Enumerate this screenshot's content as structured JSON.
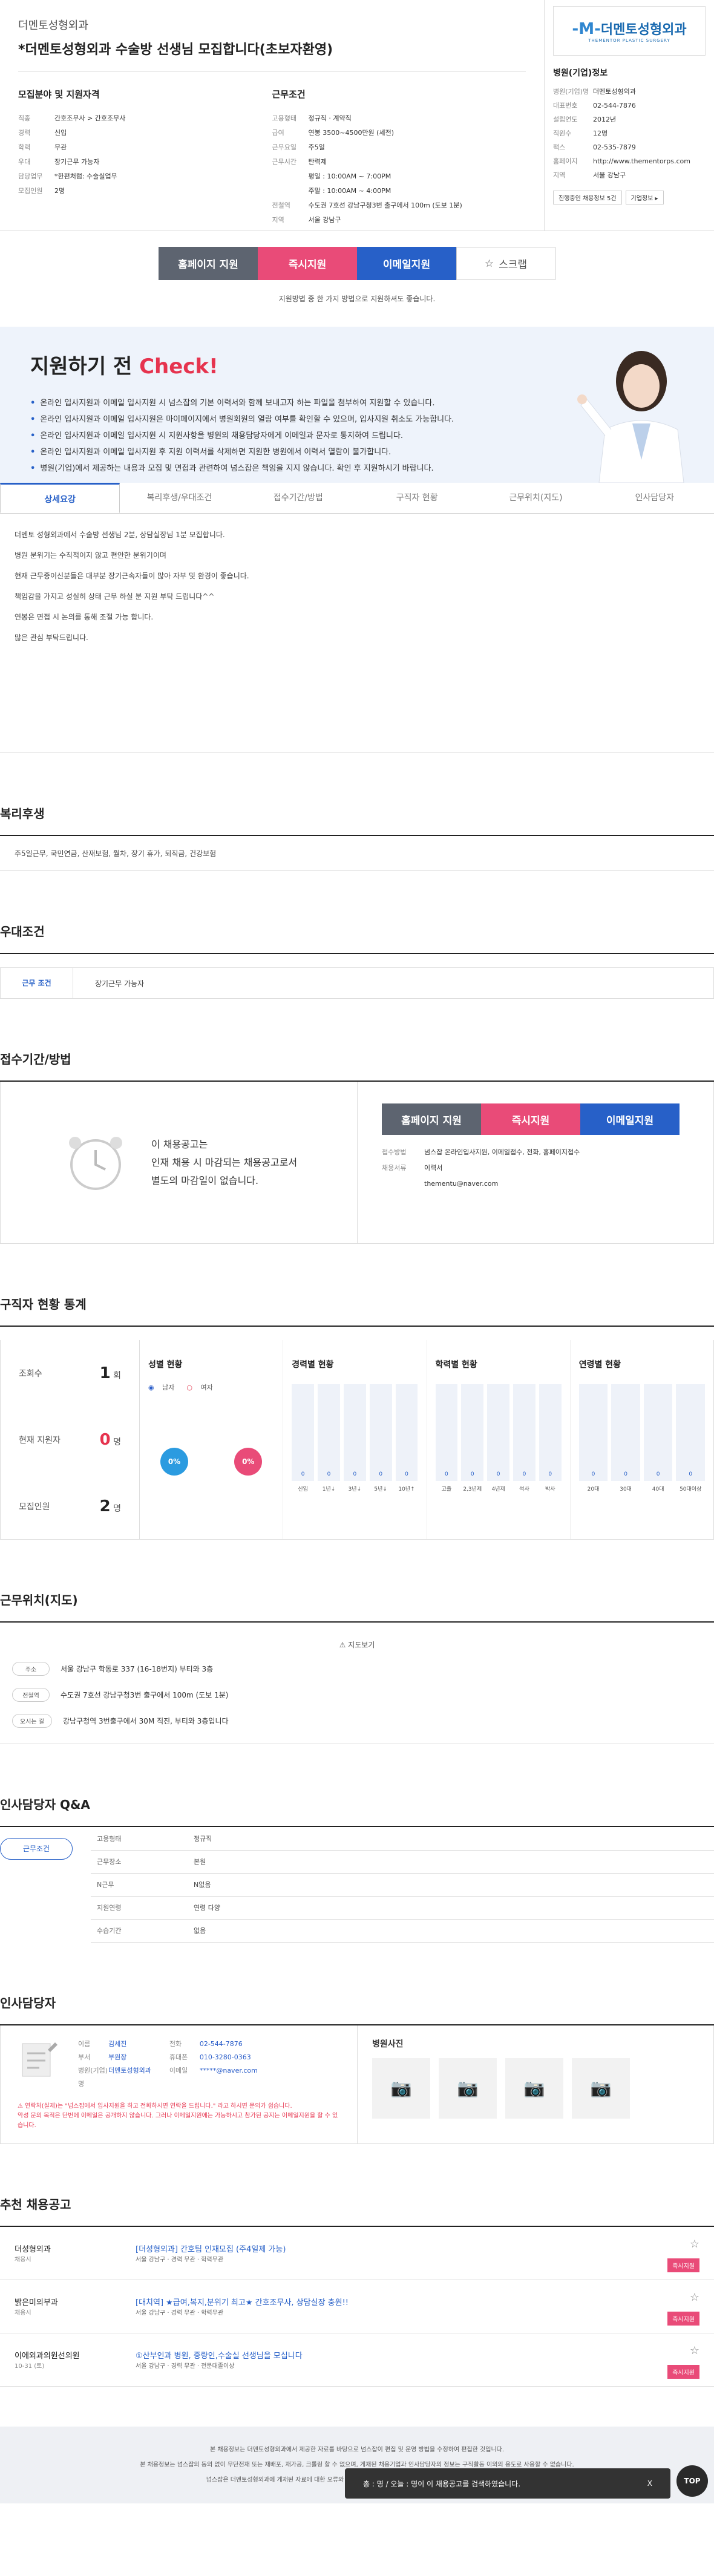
{
  "header": {
    "company": "더멘토성형외과",
    "title": "*더멘토성형외과 수술방 선생님 모집합니다(초보자환영)",
    "left_heading": "모집분야 및 지원자격",
    "left_rows": [
      {
        "k": "직종",
        "v": "간호조무사 > 간호조무사"
      },
      {
        "k": "경력",
        "v": "신입"
      },
      {
        "k": "학력",
        "v": "무관"
      },
      {
        "k": "우대",
        "v": "장기근무 가능자"
      },
      {
        "k": "담당업무",
        "v": "*한편처럼: 수술실업무"
      },
      {
        "k": "모집인원",
        "v": "2명"
      }
    ],
    "right_heading": "근무조건",
    "right_rows": [
      {
        "k": "고용형태",
        "v": "정규직 · 계약직"
      },
      {
        "k": "급여",
        "v": "연봉 3500~4500만원 (세전)"
      },
      {
        "k": "근무요일",
        "v": "주5일"
      },
      {
        "k": "근무시간",
        "v": "탄력제"
      },
      {
        "k": "",
        "v": "평일 : 10:00AM ~ 7:00PM"
      },
      {
        "k": "",
        "v": "주말 : 10:00AM ~ 4:00PM"
      },
      {
        "k": "전철역",
        "v": "수도권 7호선 강남구청3번 출구에서 100m (도보 1분)"
      },
      {
        "k": "지역",
        "v": "서울 강남구"
      }
    ],
    "map_btn": "지도"
  },
  "hospital": {
    "logo_text": "더멘토성형외과",
    "logo_sub": "THEMENTOR PLASTIC SURGERY",
    "heading": "병원(기업)정보",
    "rows": [
      {
        "k": "병원(기업)명",
        "v": "더멘토성형외과"
      },
      {
        "k": "대표번호",
        "v": "02-544-7876"
      },
      {
        "k": "설립연도",
        "v": "2012년"
      },
      {
        "k": "직원수",
        "v": "12명"
      },
      {
        "k": "팩스",
        "v": "02-535-7879"
      },
      {
        "k": "홈페이지",
        "v": "http://www.thementorps.com"
      },
      {
        "k": "지역",
        "v": "서울 강남구"
      }
    ],
    "btn1": "진행중인 채용정보 5건",
    "btn2": "기업정보 ▸"
  },
  "apply": {
    "homepage": "홈페이지 지원",
    "quick": "즉시지원",
    "email": "이메일지원",
    "scrap": "스크랩",
    "note": "지원방법 중 한 가지 방법으로 지원하셔도 좋습니다."
  },
  "check": {
    "title_a": "지원하기 전",
    "title_b": "Check!",
    "items": [
      "온라인 입사지원과 이메일 입사지원 시 넘스잡의 기본 이력서와 함께 보내고자 하는 파일을 첨부하여 지원할 수 있습니다.",
      "온라인 입사지원과 이메일 입사지원은 마이페이지에서 병원회원의 열람 여부를 확인할 수 있으며, 입사지원 취소도 가능합니다.",
      "온라인 입사지원과 이메일 입사지원 시 지원사항을 병원의 채용담당자에게 이메일과 문자로 통지하여 드립니다.",
      "온라인 입사지원과 이메일 입사지원 후 지원 이력서를 삭제하면 지원한 병원에서 이력서 열람이 불가합니다.",
      "병원(기업)에서 제공하는 내용과 모집 및 면접과 관련하여 넘스잡은 책임을 지지 않습니다. 확인 후 지원하시기 바랍니다."
    ]
  },
  "tabs": [
    "상세요강",
    "복리후생/우대조건",
    "접수기간/방법",
    "구직자 현황",
    "근무위치(지도)",
    "인사담당자"
  ],
  "summary": [
    "더멘토 성형외과에서 수술방 선생님 2분, 상담실장님 1분 모집합니다.",
    "병원 분위기는 수직적이지 않고 편안한 분위기이며",
    "현재 근무중이신분들은 대부분 장기근속자들이 많아 자부 및 환경이 좋습니다.",
    "책임감을 가지고 성실히 상태 근무 하실 분 지원 부탁 드립니다^^",
    "연봉은 면접 시 논의를 통해 조절 가능 합니다.",
    "많은 관심 부탁드립니다."
  ],
  "welfare": {
    "title": "복리후생",
    "text": "주5일근무, 국민연금, 산재보험, 월차, 장기 휴가, 퇴직금, 건강보험"
  },
  "pref": {
    "title": "우대조건",
    "k": "근무 조건",
    "v": "장기근무 가능자"
  },
  "deadline": {
    "title": "접수기간/방법",
    "msg": [
      "이 채용공고는",
      "인재 채용 시 마감되는 채용공고로서",
      "별도의 마감일이 없습니다."
    ],
    "rows": [
      {
        "k": "접수방법",
        "v": "넘스잡 온라인입사지원, 이메일접수, 전화, 홈페이지접수"
      },
      {
        "k": "채용서류",
        "v": "이력서"
      },
      {
        "k": "",
        "v": "thementu@naver.com"
      }
    ]
  },
  "stats": {
    "title": "구직자 현황 통계",
    "counts": [
      {
        "k": "조회수",
        "v": "1",
        "u": "회",
        "red": false
      },
      {
        "k": "현재 지원자",
        "v": "0",
        "u": "명",
        "red": true
      },
      {
        "k": "모집인원",
        "v": "2",
        "u": "명",
        "red": false
      }
    ],
    "gender_title": "성별 현황",
    "male": "남자",
    "female": "여자",
    "male_pct": "0%",
    "female_pct": "0%",
    "career_title": "경력별 현황",
    "career": [
      {
        "l": "신입",
        "v": 0
      },
      {
        "l": "1년↓",
        "v": 0
      },
      {
        "l": "3년↓",
        "v": 0
      },
      {
        "l": "5년↓",
        "v": 0
      },
      {
        "l": "10년↑",
        "v": 0
      }
    ],
    "edu_title": "학력별 현황",
    "edu": [
      {
        "l": "고졸",
        "v": 0
      },
      {
        "l": "2,3년제",
        "v": 0
      },
      {
        "l": "4년제",
        "v": 0
      },
      {
        "l": "석사",
        "v": 0
      },
      {
        "l": "박사",
        "v": 0
      }
    ],
    "age_title": "연령별 현황",
    "age": [
      {
        "l": "20대",
        "v": 0
      },
      {
        "l": "30대",
        "v": 0
      },
      {
        "l": "40대",
        "v": 0
      },
      {
        "l": "50대이상",
        "v": 0
      }
    ]
  },
  "location": {
    "title": "근무위치(지도)",
    "map_btn": "지도보기",
    "rows": [
      {
        "k": "주소",
        "v": "서울 강남구 학동로 337 (16-18번지) 부티와 3층"
      },
      {
        "k": "전철역",
        "v": "수도권 7호선 강남구청3번 출구에서 100m (도보 1분)"
      },
      {
        "k": "오시는 길",
        "v": "강남구청역 3번출구에서 30M 직진, 부티와 3층입니다"
      }
    ]
  },
  "qa": {
    "title": "인사담당자 Q&A",
    "tab": "근무조건",
    "rows": [
      {
        "k": "고용형태",
        "v": "정규직"
      },
      {
        "k": "근무장소",
        "v": "본원"
      },
      {
        "k": "N근무",
        "v": "N없음"
      },
      {
        "k": "지원연령",
        "v": "연령 다양"
      },
      {
        "k": "수습기간",
        "v": "없음"
      }
    ]
  },
  "manager": {
    "title": "인사담당자",
    "rows_a": [
      {
        "k": "이름",
        "v": "김세진"
      },
      {
        "k": "부서",
        "v": "부원장"
      },
      {
        "k": "병원(기업)명",
        "v": "더멘토성형외과"
      }
    ],
    "rows_b": [
      {
        "k": "전화",
        "v": "02-544-7876"
      },
      {
        "k": "휴대폰",
        "v": "010-3280-0363"
      },
      {
        "k": "이메일",
        "v": "*****@naver.com"
      }
    ],
    "warn1": "연락처(실제)는 \"넘스잡에서 입사지원을 하고 전화하시면 연락을 드립니다.\" 라고 하시면 문의가 쉽습니다.",
    "warn2": "악성 문의 목적은 단번에 이메일은 공개하지 않습니다. 그러나 이메일지원에는 가능하시고 참가된 공지는 이메일지원을 할 수 있습니다.",
    "photo_title": "병원사진"
  },
  "recommend": {
    "title": "추천 채용공고",
    "items": [
      {
        "co": "더성형외과",
        "loc": "채용시",
        "title": "[더성형외과] 간호팀 인재모집 (주4일제 가능)",
        "meta": "서울 강남구 · 경력 무관 · 학력무관"
      },
      {
        "co": "밝은미의부과",
        "loc": "채용시",
        "title": "[대치역] ★급여,복지,분위기 최고★ 간호조무사, 상담실장 충원!!",
        "meta": "서울 강남구 · 경력 무관 · 학력무관"
      },
      {
        "co": "이에외과의원선의원",
        "loc": "10-31 (토)",
        "title": "①산부인과 병원, 중량인,수술실 선생님을 모십니다",
        "meta": "서울 강남구 · 경력 무관 · 전문대졸이상"
      }
    ],
    "apply_label": "즉시지원"
  },
  "notice": [
    "본 채용정보는 더멘토성형외과에서 제공한 자료를 바탕으로 넘스잡이 편집 및 운영 방법을 수정하여 편집한 것입니다.",
    "본 채용정보는 넘스잡의 동의 없이 무단전재 또는 재배포, 재가공, 크롤링 할 수 없으며, 게재된 채용기업과 인사담당자의 정보는 구직활동 이외의 용도로 사용할 수 없습니다.",
    "넘스잡은 더멘토성형외과에 게재된 자료에 대한 오류와 사용자가 이를 신뢰하여 취한 조치에 대해 책임을 지지 않습니다."
  ],
  "searchbar": {
    "text": "총 : 명 / 오늘 : 명이 이 채용공고를 검색하였습니다.",
    "close": "X"
  },
  "top": "TOP"
}
